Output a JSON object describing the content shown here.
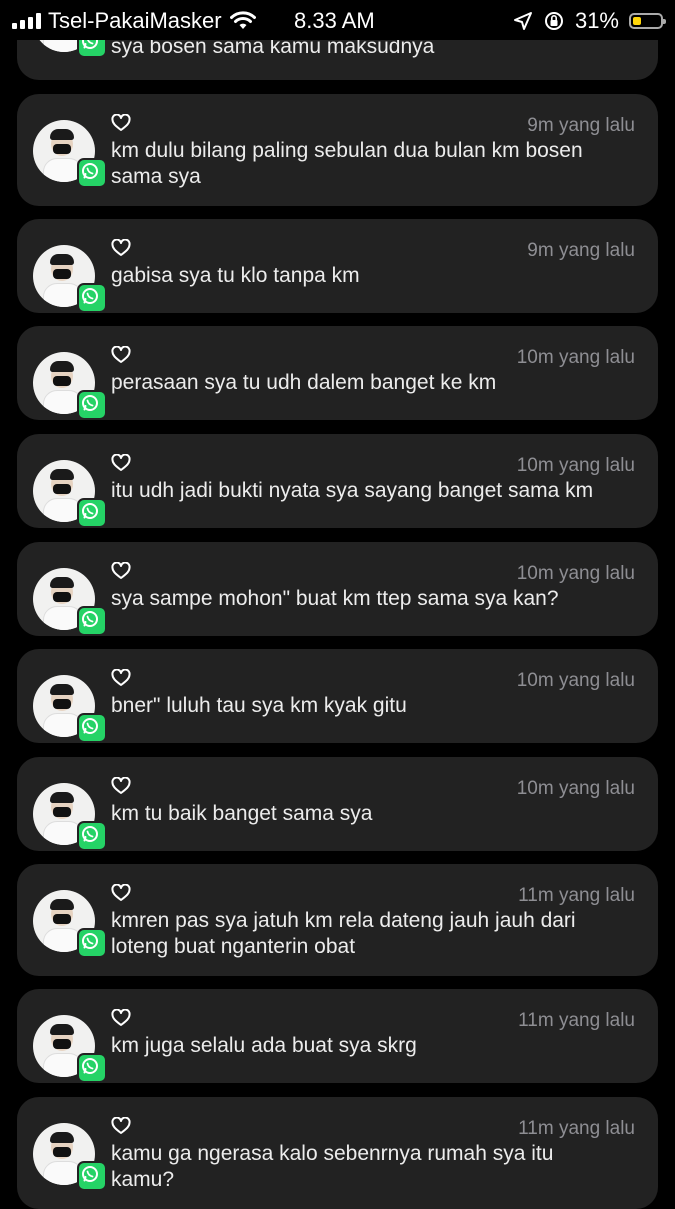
{
  "status_bar": {
    "carrier": "Tsel-PakaiMasker",
    "time": "8.33 AM",
    "battery": "31%",
    "battery_level": 0.31,
    "battery_color": "#ffd60a"
  },
  "notifications": [
    {
      "time": "",
      "text": "sya bosen sama kamu maksudnya",
      "app_icon": "whatsapp-icon"
    },
    {
      "time": "9m yang lalu",
      "text": "km dulu bilang paling sebulan dua bulan km bosen sama sya",
      "app_icon": "whatsapp-icon"
    },
    {
      "time": "9m yang lalu",
      "text": "gabisa sya tu klo tanpa km",
      "app_icon": "whatsapp-icon"
    },
    {
      "time": "10m yang lalu",
      "text": "perasaan sya tu udh dalem banget ke km",
      "app_icon": "whatsapp-icon"
    },
    {
      "time": "10m yang lalu",
      "text": "itu udh jadi bukti nyata sya sayang banget sama km",
      "app_icon": "whatsapp-icon"
    },
    {
      "time": "10m yang lalu",
      "text": "sya sampe mohon\" buat km ttep sama sya kan?",
      "app_icon": "whatsapp-icon"
    },
    {
      "time": "10m yang lalu",
      "text": "bner\" luluh tau sya km kyak gitu",
      "app_icon": "whatsapp-icon"
    },
    {
      "time": "10m yang lalu",
      "text": "km tu baik banget sama sya",
      "app_icon": "whatsapp-icon"
    },
    {
      "time": "11m yang lalu",
      "text": "kmren pas sya jatuh km rela dateng jauh jauh dari loteng buat nganterin obat",
      "app_icon": "whatsapp-icon"
    },
    {
      "time": "11m yang lalu",
      "text": "km juga selalu ada buat sya skrg",
      "app_icon": "whatsapp-icon"
    },
    {
      "time": "11m yang lalu",
      "text": "kamu ga ngerasa kalo sebenrnya rumah sya itu kamu?",
      "app_icon": "whatsapp-icon"
    }
  ]
}
